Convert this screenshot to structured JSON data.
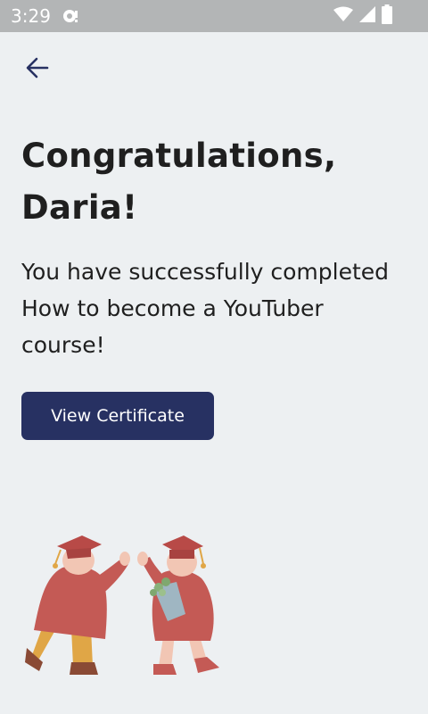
{
  "status_bar": {
    "time": "3:29",
    "icons": [
      "notification-icon",
      "wifi-icon",
      "signal-icon",
      "battery-icon"
    ]
  },
  "header": {
    "back_icon": "back-arrow-icon"
  },
  "main": {
    "title": "Congratulations, Daria!",
    "message": "You have successfully completed How to become a YouTuber course!",
    "certificate_button_label": "View Certificate",
    "illustration": "graduates-high-five-illustration"
  },
  "colors": {
    "background": "#edf0f2",
    "status_bar": "#b3b5b6",
    "primary_button": "#273162",
    "text": "#1f1f1f",
    "figure_red": "#c45a55",
    "figure_pants": "#e0a646"
  }
}
